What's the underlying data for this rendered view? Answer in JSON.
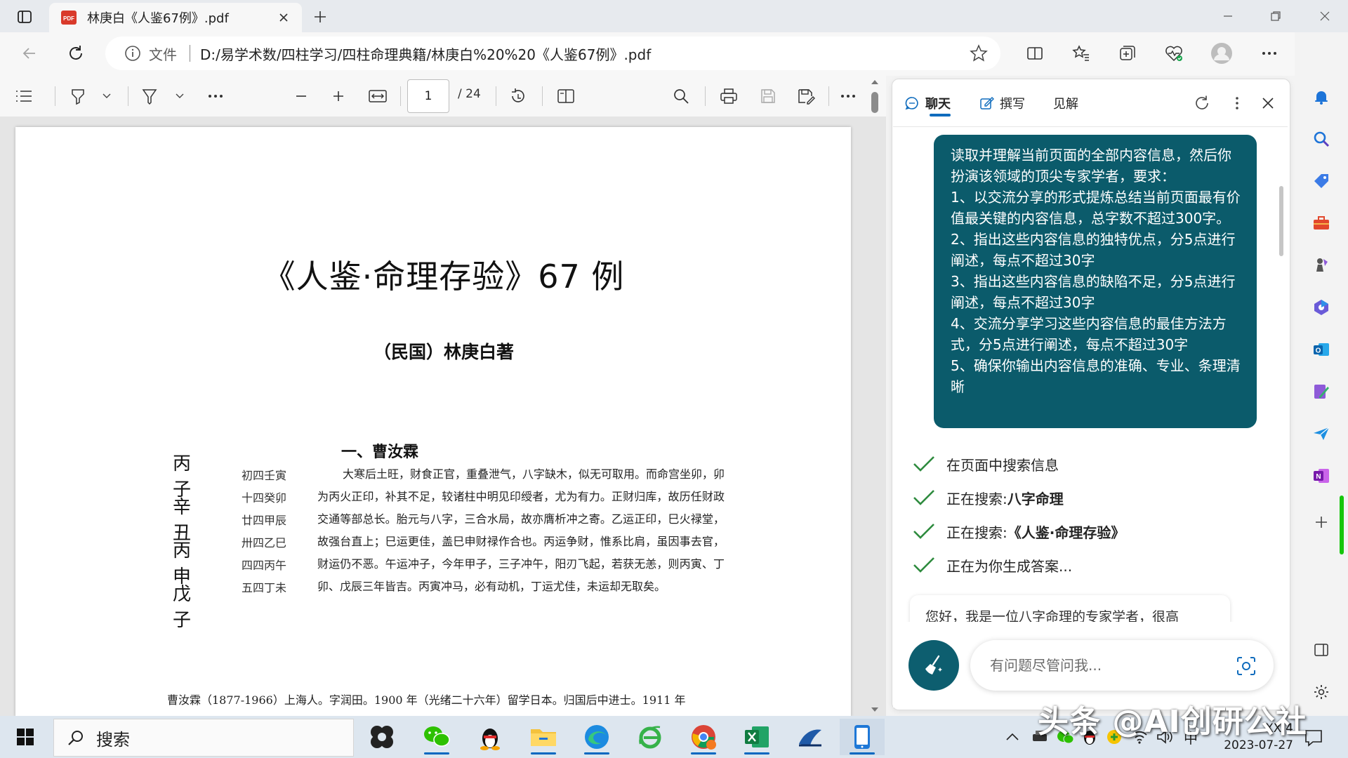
{
  "browser": {
    "tab_title": "林庚白《人鉴67例》.pdf",
    "address_scheme": "文件",
    "address_url": "D:/易学术数/四柱学习/四柱命理典籍/林庚白%20%20《人鉴67例》.pdf"
  },
  "pdf_toolbar": {
    "page_current": "1",
    "page_total": "/ 24"
  },
  "document": {
    "title": "《人鉴·命理存验》67 例",
    "author": "（民国）林庚白著",
    "pillars": [
      "丙 子",
      "辛 丑",
      "丙 申",
      "戊 子"
    ],
    "dayun": [
      "初四壬寅",
      "十四癸卯",
      "廿四甲辰",
      "卅四乙巳",
      "四四丙午",
      "五四丁未"
    ],
    "section_heading": "一、曹汝霖",
    "case_text": "大寒后土旺，财食正官，重叠泄气，八字缺木，似无可取用。而命宫坐卯，卯为丙火正印，补其不足，较诸柱中明见印绶者，尤为有力。正财归库，故历任财政交通等部总长。胎元与八字，三合水局，故亦膺析冲之寄。乙运正印，巳火禄堂，故强台直上；巳运更佳，盖巳申财禄作合也。丙运争财，惟系比肩，虽因事去官，财运仍不恶。午运冲子，今年甲子，三子冲午，阳刃飞起，若获无恙，则丙寅、丁卯、戊辰三年皆吉。丙寅冲马，必有动机，丁运尤佳，未运却无取矣。",
    "footnote": "曹汝霖（1877-1966）上海人。字润田。1900 年（光绪二十六年）留学日本。归国后中进士。1911 年"
  },
  "copilot": {
    "tabs": [
      "聊天",
      "撰写",
      "见解"
    ],
    "prompt": "读取并理解当前页面的全部内容信息，然后你扮演该领域的顶尖专家学者，要求：\n1、以交流分享的形式提炼总结当前页面最有价值最关键的内容信息，总字数不超过300字。\n2、指出这些内容信息的独特优点，分5点进行阐述，每点不超过30字\n3、指出这些内容信息的缺陷不足，分5点进行阐述，每点不超过30字\n4、交流分享学习这些内容信息的最佳方法方式，分5点进行阐述，每点不超过30字\n5、确保你输出内容信息的准确、专业、条理清晰",
    "steps": [
      {
        "prefix": "在页面中搜索信息",
        "bold": ""
      },
      {
        "prefix": "正在搜索: ",
        "bold": "八字命理"
      },
      {
        "prefix": "正在搜索: ",
        "bold": "《人鉴·命理存验》"
      },
      {
        "prefix": "正在为你生成答案...",
        "bold": ""
      }
    ],
    "answer_preview": "您好，我是一位八字命理的专家学者，很高",
    "input_placeholder": "有问题尽管问我..."
  },
  "taskbar": {
    "search_label": "搜索",
    "ime": "中",
    "clock_time": "XX:4",
    "clock_date": "2023-07-27"
  },
  "watermark": "头条 @AI创研公社",
  "colors": {
    "accent": "#0f6cbd",
    "prompt_bubble": "#0b5b6b",
    "check": "#2e8b3e"
  }
}
